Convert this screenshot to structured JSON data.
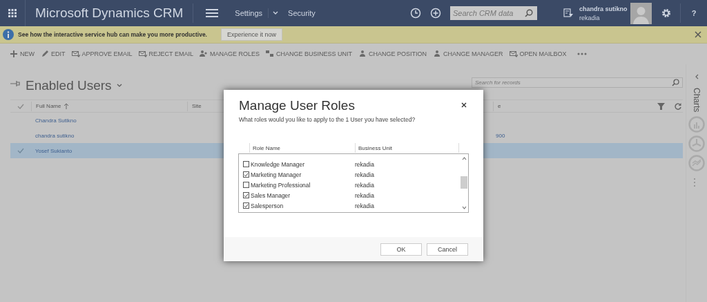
{
  "app_bar": {
    "title": "Microsoft Dynamics CRM",
    "nav": [
      {
        "label": "Settings"
      },
      {
        "label": "Security"
      }
    ],
    "search": {
      "placeholder": "Search CRM data"
    },
    "user": {
      "name": "chandra sutikno",
      "org": "rekadia"
    },
    "help": "?"
  },
  "notification": {
    "message": "See how the interactive service hub can make you more productive.",
    "button": "Experience it now"
  },
  "command_bar": {
    "commands": [
      {
        "label": "NEW",
        "kind": "plus"
      },
      {
        "label": "EDIT",
        "kind": "pencil"
      },
      {
        "label": "APPROVE EMAIL",
        "kind": "mail"
      },
      {
        "label": "REJECT EMAIL",
        "kind": "mail"
      },
      {
        "label": "MANAGE ROLES",
        "kind": "people"
      },
      {
        "label": "CHANGE BUSINESS UNIT",
        "kind": "blocks"
      },
      {
        "label": "CHANGE POSITION",
        "kind": "person"
      },
      {
        "label": "CHANGE MANAGER",
        "kind": "person"
      },
      {
        "label": "OPEN MAILBOX",
        "kind": "mail"
      }
    ]
  },
  "view": {
    "title": "Enabled Users",
    "search": {
      "placeholder": "Search for records"
    }
  },
  "grid": {
    "columns": [
      {
        "label": "Full Name",
        "sort_ascending": true
      },
      {
        "label": "Site",
        "sort_ascending": false
      },
      {
        "label": "e",
        "sort_ascending": false
      }
    ],
    "rows": [
      {
        "full_name": "Chandra Sutikno",
        "selected": false
      },
      {
        "full_name": "chandra sutikno",
        "column_3": "900",
        "selected": false
      },
      {
        "full_name": "Yosef Sukianto",
        "selected": true
      }
    ]
  },
  "side_pane": {
    "title": "Charts"
  },
  "dialog": {
    "title": "Manage User Roles",
    "prompt": "What roles would you like to apply to the 1 User you have selected?",
    "columns": [
      "Role Name",
      "Business Unit"
    ],
    "roles": [
      {
        "name": "Knowledge Manager",
        "business_unit": "rekadia",
        "checked": false
      },
      {
        "name": "Marketing Manager",
        "business_unit": "rekadia",
        "checked": true
      },
      {
        "name": "Marketing Professional",
        "business_unit": "rekadia",
        "checked": false
      },
      {
        "name": "Sales Manager",
        "business_unit": "rekadia",
        "checked": true
      },
      {
        "name": "Salesperson",
        "business_unit": "rekadia",
        "checked": true
      }
    ],
    "buttons": [
      "OK",
      "Cancel"
    ]
  }
}
